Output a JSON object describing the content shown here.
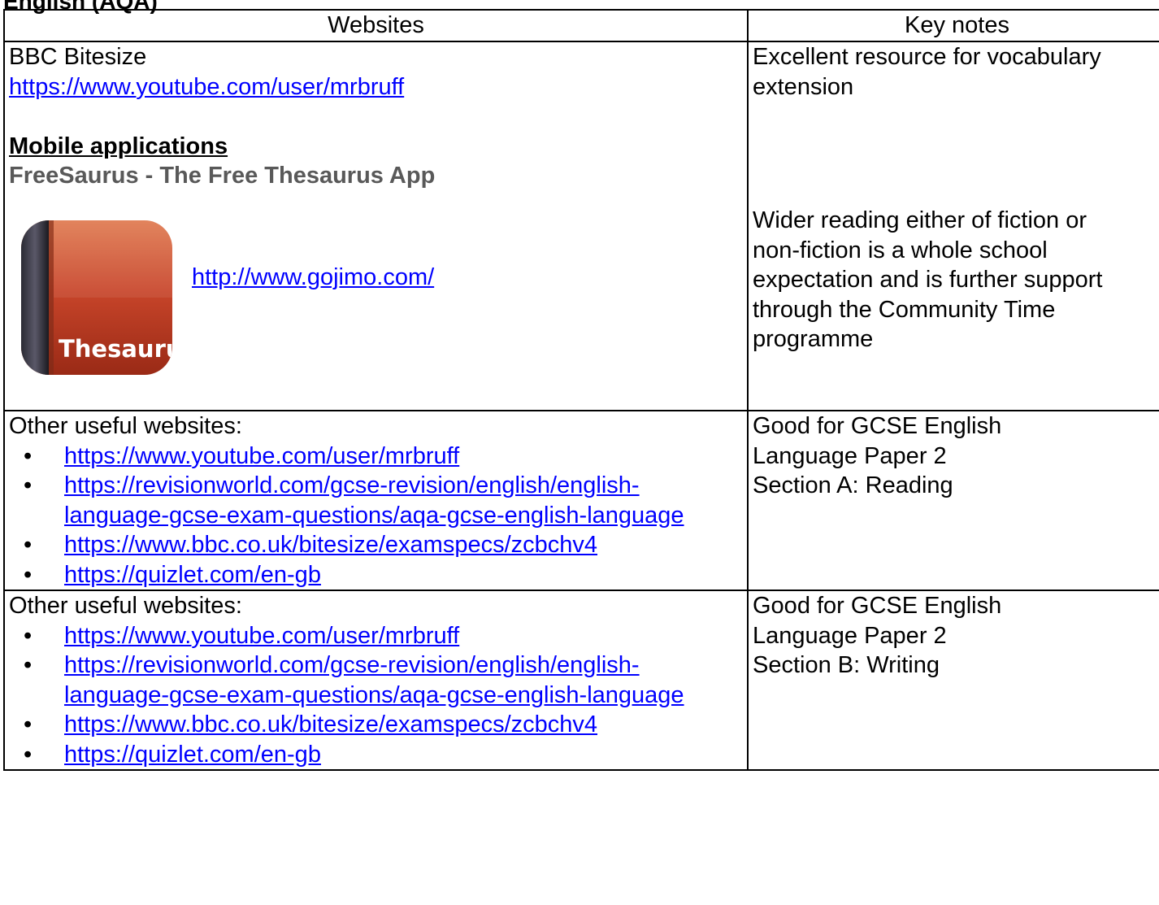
{
  "document": {
    "title": "English (AQA)"
  },
  "table": {
    "headers": {
      "websites": "Websites",
      "key_notes": "Key notes"
    },
    "row1": {
      "site_name": "BBC Bitesize",
      "site_link": "https://www.youtube.com/user/mrbruff",
      "mobile_heading": "Mobile applications",
      "app_name": "FreeSaurus - The Free Thesaurus App",
      "app_icon_text": "Thesaurus",
      "app_link": "http://www.gojimo.com/",
      "note_1_line_1": "Excellent resource for vocabulary",
      "note_1_line_2": "extension",
      "note_2_line_1": "Wider reading either of fiction or",
      "note_2_line_2": "non-fiction is a whole school",
      "note_2_line_3": "expectation and is further support",
      "note_2_line_4": "through the Community Time",
      "note_2_line_5": "programme"
    },
    "row2": {
      "intro": "Other useful websites:",
      "links": [
        "https://www.youtube.com/user/mrbruff",
        "https://revisionworld.com/gcse-revision/english/english-language-gcse-exam-questions/aqa-gcse-english-language",
        "https://www.bbc.co.uk/bitesize/examspecs/zcbchv4",
        "https://quizlet.com/en-gb"
      ],
      "note_line_1": "Good for GCSE English",
      "note_line_2": "Language Paper 2",
      "note_line_3": "Section A: Reading"
    },
    "row3": {
      "intro": "Other useful websites:",
      "links": [
        "https://www.youtube.com/user/mrbruff",
        "https://revisionworld.com/gcse-revision/english/english-language-gcse-exam-questions/aqa-gcse-english-language",
        "https://www.bbc.co.uk/bitesize/examspecs/zcbchv4",
        "https://quizlet.com/en-gb"
      ],
      "note_line_1": "Good for GCSE English",
      "note_line_2": "Language Paper 2",
      "note_line_3": "Section B: Writing"
    }
  }
}
